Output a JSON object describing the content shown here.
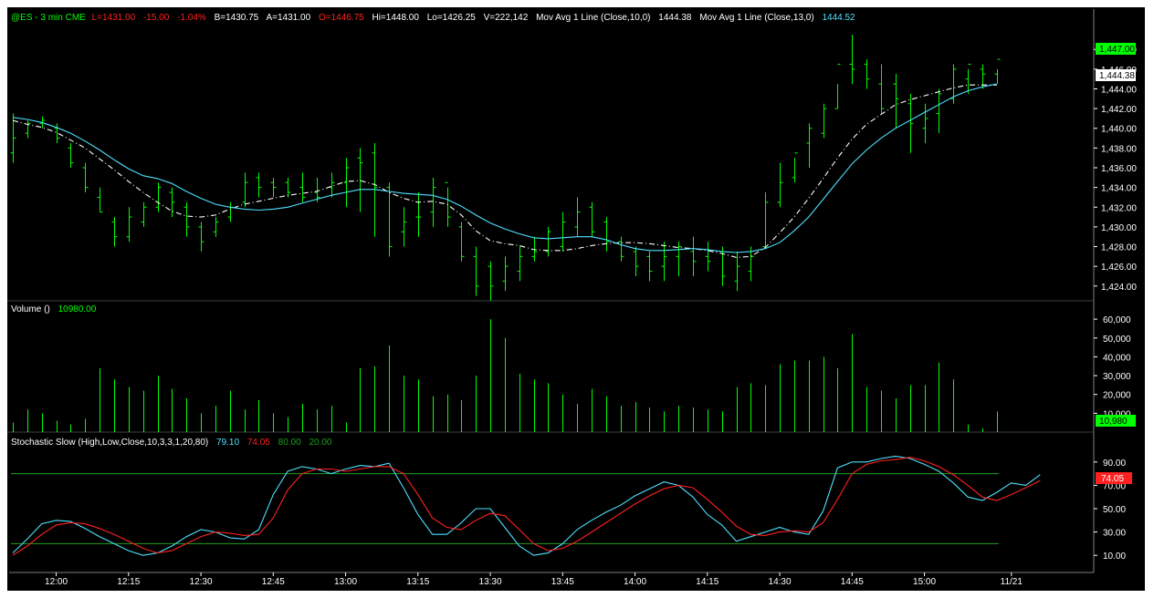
{
  "colors": {
    "background": "#000000",
    "bars": "#00ff00",
    "ma10": "#ffffff",
    "ma13": "#4fe0ff",
    "stoch_k": "#4fe0ff",
    "stoch_d": "#ff2020",
    "stoch_levels": "#1f9e1f",
    "axis_text": "#ffffff",
    "grid": "#808080"
  },
  "price_header": {
    "symbol": "@ES - 3 min  CME",
    "last": "L=1431.00",
    "change": "-15.00",
    "change_pct": "-1.04%",
    "bid": "B=1430.75",
    "ask": "A=1431.00",
    "open": "O=1446.75",
    "high": "Hi=1448.00",
    "low": "Lo=1426.25",
    "volume": "V=222,142",
    "ma10_label": "Mov Avg 1 Line (Close,10,0)",
    "ma10_value": "1444.38",
    "ma13_label": "Mov Avg 1 Line (Close,13,0)",
    "ma13_value": "1444.52"
  },
  "volume_header": {
    "label": "Volume ()",
    "value": "10980.00"
  },
  "stoch_header": {
    "label": "Stochastic Slow (High,Low,Close,10,3,3,1,20,80)",
    "k_value": "79.10",
    "d_value": "74.05",
    "upper": "80.00",
    "lower": "20.00"
  },
  "price_axis": {
    "ticks": [
      "1,448.00",
      "1,446.00",
      "1,444.00",
      "1,442.00",
      "1,440.00",
      "1,438.00",
      "1,436.00",
      "1,434.00",
      "1,432.00",
      "1,430.00",
      "1,428.00",
      "1,426.00",
      "1,424.00"
    ],
    "last_marker": "1,447.00",
    "ma_marker": "1,444.38"
  },
  "volume_axis": {
    "ticks": [
      "60,000",
      "50,000",
      "40,000",
      "30,000",
      "20,000",
      "10,000"
    ],
    "last_marker": "10,980"
  },
  "stoch_axis": {
    "ticks": [
      "90.00",
      "70.00",
      "50.00",
      "30.00",
      "10.00"
    ],
    "last_marker": "74.05"
  },
  "time_axis": {
    "labels": [
      "12:00",
      "12:15",
      "12:30",
      "12:45",
      "13:00",
      "13:15",
      "13:30",
      "13:45",
      "14:00",
      "14:15",
      "14:30",
      "14:45",
      "15:00",
      "11/21"
    ]
  },
  "chart_data": [
    {
      "type": "ohlc",
      "title": "@ES - 3 min CME",
      "ylim": [
        1422.5,
        1449.5
      ],
      "bar_interval_minutes": 3,
      "x": [
        "11:51",
        "11:54",
        "11:57",
        "12:00",
        "12:03",
        "12:06",
        "12:09",
        "12:12",
        "12:15",
        "12:18",
        "12:21",
        "12:24",
        "12:27",
        "12:30",
        "12:33",
        "12:36",
        "12:39",
        "12:42",
        "12:45",
        "12:48",
        "12:51",
        "12:54",
        "12:57",
        "13:00",
        "13:03",
        "13:06",
        "13:09",
        "13:12",
        "13:15",
        "13:18",
        "13:21",
        "13:24",
        "13:27",
        "13:30",
        "13:33",
        "13:36",
        "13:39",
        "13:42",
        "13:45",
        "13:48",
        "13:51",
        "13:54",
        "13:57",
        "14:00",
        "14:03",
        "14:06",
        "14:09",
        "14:12",
        "14:15",
        "14:18",
        "14:21",
        "14:24",
        "14:27",
        "14:30",
        "14:33",
        "14:36",
        "14:39",
        "14:42",
        "14:45",
        "14:48",
        "14:51",
        "14:54",
        "14:57",
        "15:00",
        "15:03",
        "15:06",
        "15:09",
        "15:12",
        "15:15"
      ],
      "high": [
        1441.5,
        1440.8,
        1441.2,
        1440.5,
        1438.5,
        1436.5,
        1434.0,
        1431.0,
        1432.0,
        1432.5,
        1434.5,
        1434.0,
        1432.5,
        1430.5,
        1431.0,
        1432.5,
        1435.5,
        1435.5,
        1435.0,
        1435.0,
        1435.5,
        1435.0,
        1435.5,
        1437.0,
        1438.0,
        1438.5,
        1434.5,
        1432.0,
        1433.5,
        1435.0,
        1434.0,
        1430.5,
        1428.0,
        1426.5,
        1427.0,
        1428.0,
        1429.0,
        1430.0,
        1431.5,
        1433.0,
        1432.5,
        1431.0,
        1429.0,
        1428.0,
        1427.5,
        1428.5,
        1428.5,
        1429.0,
        1428.5,
        1428.0,
        1427.5,
        1428.0,
        1433.5,
        1436.5,
        1437.0,
        1440.5,
        1442.5,
        1444.5,
        1449.5,
        1447.0,
        1446.5,
        1445.5,
        1443.5,
        1442.5,
        1444.0,
        1446.5,
        1446.0,
        1446.5,
        1446.0
      ],
      "low": [
        1436.5,
        1439.0,
        1440.0,
        1438.5,
        1436.0,
        1433.5,
        1431.5,
        1428.0,
        1428.5,
        1430.0,
        1431.5,
        1431.0,
        1429.0,
        1427.5,
        1429.0,
        1430.5,
        1432.0,
        1433.0,
        1433.0,
        1433.0,
        1432.5,
        1432.5,
        1433.0,
        1432.0,
        1431.5,
        1429.0,
        1427.0,
        1428.0,
        1429.0,
        1430.0,
        1430.0,
        1426.5,
        1423.0,
        1422.5,
        1423.5,
        1424.5,
        1426.5,
        1427.0,
        1427.5,
        1429.0,
        1429.0,
        1427.5,
        1426.5,
        1425.0,
        1424.5,
        1424.5,
        1425.0,
        1425.0,
        1425.5,
        1424.0,
        1423.5,
        1424.5,
        1428.0,
        1432.0,
        1434.5,
        1436.0,
        1439.0,
        1442.0,
        1444.5,
        1444.0,
        1441.5,
        1440.0,
        1437.5,
        1438.5,
        1439.5,
        1442.5,
        1443.5,
        1444.0,
        1444.5
      ],
      "open": [
        1437.5,
        1439.5,
        1440.5,
        1440.0,
        1438.0,
        1436.0,
        1433.0,
        1430.5,
        1429.0,
        1430.5,
        1432.0,
        1433.5,
        1432.0,
        1430.0,
        1429.5,
        1431.0,
        1432.5,
        1435.0,
        1434.5,
        1434.5,
        1434.0,
        1433.5,
        1434.0,
        1434.5,
        1437.0,
        1437.5,
        1434.0,
        1429.5,
        1431.0,
        1431.5,
        1434.5,
        1430.0,
        1427.0,
        1426.0,
        1424.5,
        1425.5,
        1427.0,
        1427.5,
        1428.0,
        1430.0,
        1432.0,
        1430.5,
        1428.5,
        1427.5,
        1427.0,
        1426.0,
        1427.0,
        1427.5,
        1427.0,
        1427.5,
        1424.5,
        1425.5,
        1428.0,
        1432.5,
        1435.0,
        1438.5,
        1439.5,
        1442.0,
        1446.5,
        1446.5,
        1444.5,
        1444.5,
        1442.5,
        1440.0,
        1441.5,
        1443.0,
        1445.0,
        1446.0,
        1445.5
      ],
      "close": [
        1439.0,
        1440.5,
        1440.8,
        1439.0,
        1436.5,
        1434.0,
        1431.5,
        1429.0,
        1431.0,
        1432.0,
        1434.0,
        1432.5,
        1430.0,
        1428.5,
        1430.5,
        1432.0,
        1434.5,
        1434.0,
        1434.0,
        1433.5,
        1433.0,
        1433.0,
        1434.5,
        1436.0,
        1436.5,
        1434.0,
        1428.0,
        1430.5,
        1431.0,
        1434.0,
        1431.0,
        1427.0,
        1424.0,
        1424.0,
        1426.0,
        1427.0,
        1427.5,
        1429.5,
        1430.5,
        1431.5,
        1429.5,
        1428.5,
        1427.0,
        1426.0,
        1425.5,
        1427.0,
        1428.0,
        1426.5,
        1426.5,
        1425.0,
        1426.0,
        1427.0,
        1432.5,
        1434.5,
        1437.5,
        1440.0,
        1442.0,
        1446.5,
        1446.0,
        1445.0,
        1442.0,
        1443.0,
        1440.5,
        1441.0,
        1443.5,
        1446.0,
        1446.5,
        1445.5,
        1447.0
      ]
    },
    {
      "type": "line",
      "series": [
        {
          "name": "Mov Avg 1 Line (Close,10,0)",
          "values": [
            1440.8,
            1440.4,
            1440.1,
            1439.6,
            1438.8,
            1438.0,
            1436.9,
            1435.8,
            1434.6,
            1433.5,
            1432.5,
            1431.6,
            1431.1,
            1431.0,
            1431.2,
            1431.8,
            1432.3,
            1432.6,
            1432.9,
            1433.2,
            1433.4,
            1433.6,
            1434.1,
            1434.6,
            1434.7,
            1434.3,
            1433.5,
            1432.9,
            1432.5,
            1432.6,
            1432.3,
            1431.2,
            1429.6,
            1428.6,
            1428.3,
            1428.1,
            1427.7,
            1427.6,
            1427.6,
            1427.8,
            1428.1,
            1428.3,
            1428.4,
            1428.4,
            1428.3,
            1428.1,
            1427.9,
            1427.8,
            1427.6,
            1427.3,
            1426.9,
            1427.0,
            1427.9,
            1429.4,
            1431.0,
            1432.9,
            1434.9,
            1437.0,
            1438.9,
            1440.4,
            1441.4,
            1442.4,
            1442.9,
            1443.3,
            1443.7,
            1444.1,
            1444.4,
            1444.4,
            1444.4
          ]
        },
        {
          "name": "Mov Avg 1 Line (Close,13,0)",
          "values": [
            1441.1,
            1440.9,
            1440.6,
            1440.1,
            1439.5,
            1438.7,
            1437.8,
            1436.8,
            1435.9,
            1435.2,
            1434.9,
            1434.4,
            1433.6,
            1432.9,
            1432.3,
            1432.0,
            1431.8,
            1431.7,
            1431.8,
            1432.0,
            1432.4,
            1432.8,
            1433.2,
            1433.5,
            1433.8,
            1433.8,
            1433.6,
            1433.4,
            1433.3,
            1433.2,
            1432.8,
            1432.1,
            1431.2,
            1430.4,
            1429.8,
            1429.3,
            1428.9,
            1428.8,
            1428.9,
            1429.0,
            1429.0,
            1428.7,
            1428.2,
            1427.8,
            1427.6,
            1427.6,
            1427.7,
            1427.8,
            1427.7,
            1427.5,
            1427.4,
            1427.5,
            1427.8,
            1428.4,
            1429.6,
            1431.0,
            1432.8,
            1434.6,
            1436.4,
            1437.8,
            1439.0,
            1440.0,
            1440.8,
            1441.6,
            1442.4,
            1443.2,
            1443.8,
            1444.2,
            1444.5
          ]
        }
      ]
    },
    {
      "type": "bar",
      "title": "Volume ()",
      "ylim": [
        0,
        62000
      ],
      "values": [
        5000,
        12000,
        10000,
        6000,
        4000,
        7000,
        34000,
        28000,
        24000,
        22000,
        30000,
        23000,
        18000,
        10000,
        14000,
        22000,
        12000,
        17000,
        10000,
        8000,
        15000,
        12000,
        14000,
        5000,
        34000,
        35000,
        46000,
        30000,
        28000,
        19000,
        20000,
        17000,
        30000,
        60000,
        50000,
        31000,
        28000,
        26000,
        20000,
        15000,
        23000,
        19000,
        14000,
        16000,
        13000,
        11000,
        14000,
        13000,
        12000,
        11000,
        24000,
        26000,
        25000,
        36000,
        38000,
        38000,
        40000,
        34000,
        52000,
        24000,
        22000,
        18000,
        25000,
        25000,
        37000,
        28000,
        4000,
        2000,
        10980
      ]
    },
    {
      "type": "line",
      "title": "Stochastic Slow (High,Low,Close,10,3,3,1,20,80)",
      "ylim": [
        0,
        100
      ],
      "levels": [
        80,
        20
      ],
      "series": [
        {
          "name": "Slow K",
          "values": [
            12,
            24,
            37,
            40,
            39,
            33,
            26,
            20,
            14,
            10,
            12,
            18,
            26,
            32,
            30,
            25,
            24,
            32,
            62,
            82,
            86,
            84,
            80,
            84,
            87,
            86,
            89,
            68,
            45,
            28,
            28,
            38,
            50,
            50,
            34,
            18,
            10,
            12,
            20,
            32,
            40,
            47,
            53,
            61,
            67,
            73,
            70,
            60,
            45,
            36,
            22,
            26,
            30,
            34,
            30,
            28,
            48,
            85,
            90,
            90,
            93,
            95,
            93,
            88,
            82,
            72,
            60,
            57,
            64,
            72,
            70,
            79.1
          ]
        },
        {
          "name": "Slow D",
          "values": [
            10,
            18,
            28,
            36,
            38,
            37,
            33,
            28,
            22,
            16,
            12,
            14,
            20,
            26,
            30,
            29,
            27,
            28,
            42,
            66,
            80,
            84,
            84,
            82,
            84,
            86,
            86,
            80,
            62,
            42,
            34,
            32,
            40,
            46,
            44,
            32,
            20,
            14,
            16,
            22,
            30,
            38,
            46,
            54,
            61,
            67,
            70,
            68,
            58,
            47,
            35,
            28,
            27,
            30,
            31,
            30,
            38,
            58,
            80,
            88,
            91,
            92,
            94,
            91,
            86,
            79,
            70,
            60,
            57,
            62,
            68,
            74.05
          ]
        }
      ]
    }
  ]
}
